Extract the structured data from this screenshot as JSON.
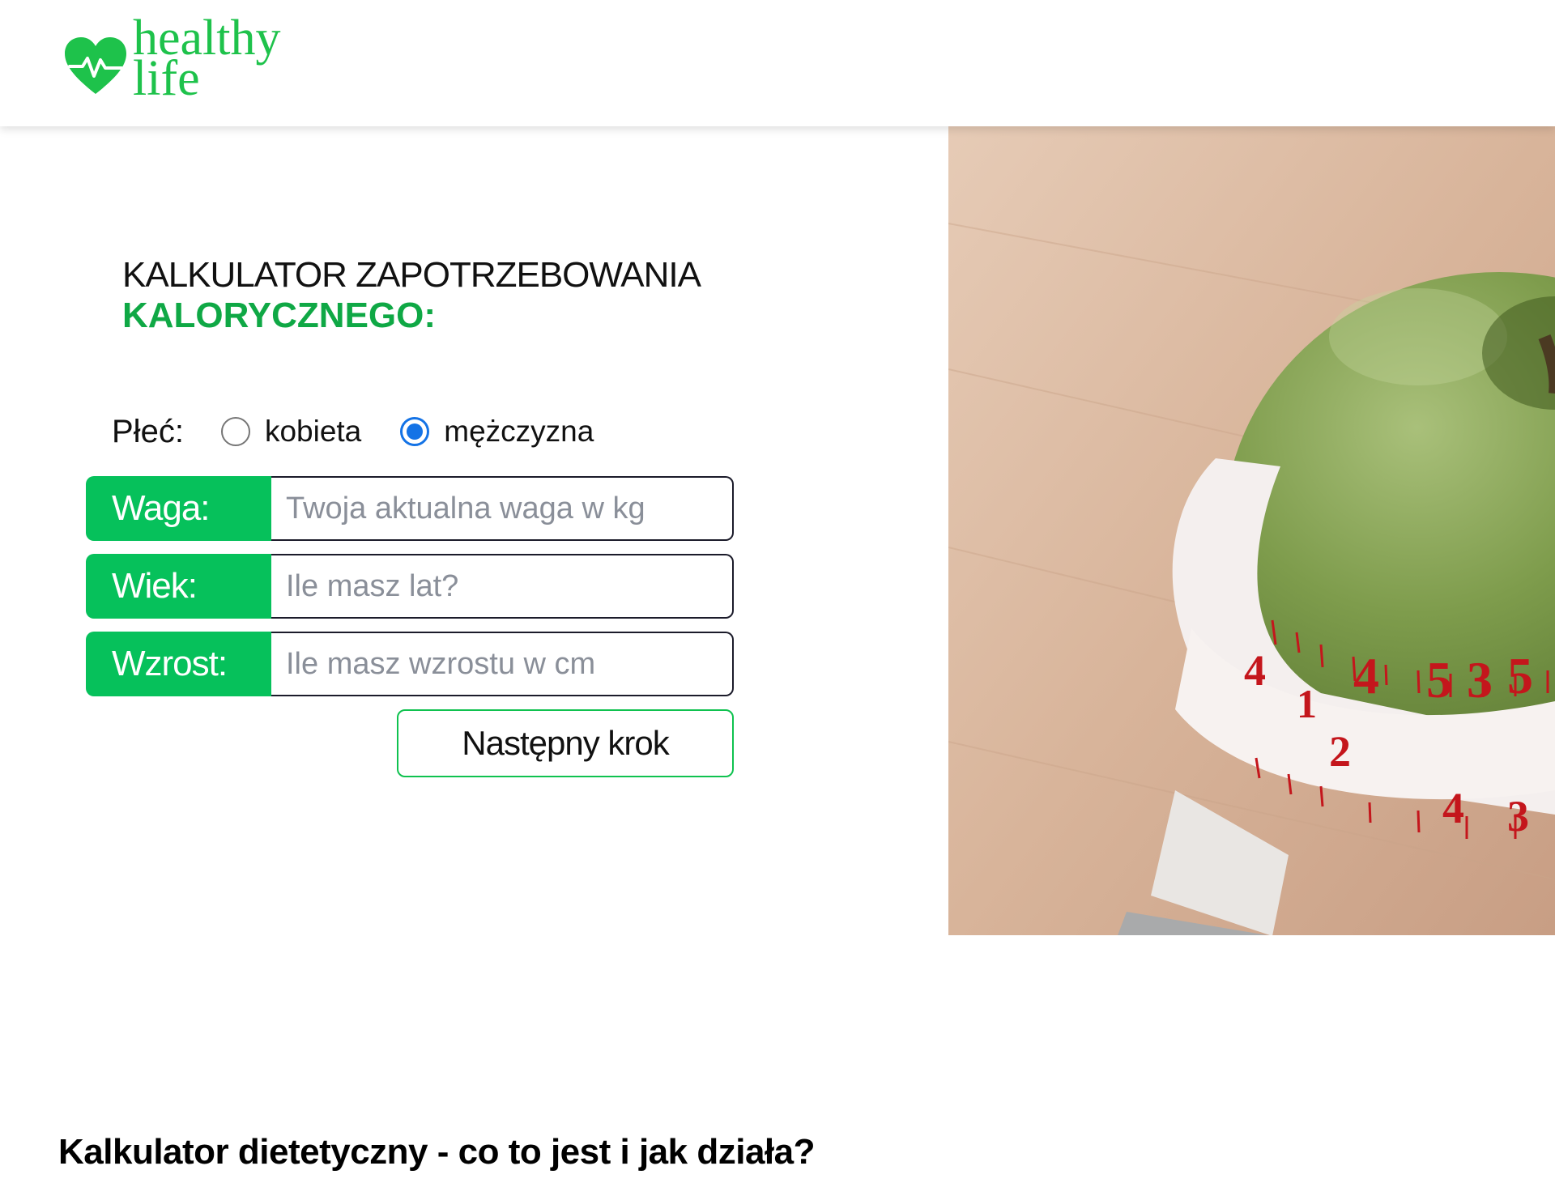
{
  "brand": {
    "name_line1": "healthy",
    "name_line2": "life",
    "color": "#1ec24b"
  },
  "calculator": {
    "title_line1": "KALKULATOR ZAPOTRZEBOWANIA",
    "title_line2": "KALORYCZNEGO:",
    "accent_color": "#06c15b",
    "gender": {
      "label": "Płeć:",
      "options": [
        {
          "label": "kobieta",
          "checked": false
        },
        {
          "label": "mężczyzna",
          "checked": true
        }
      ]
    },
    "fields": {
      "weight": {
        "label": "Waga:",
        "value": "",
        "placeholder": "Twoja aktualna waga w kg"
      },
      "age": {
        "label": "Wiek:",
        "value": "",
        "placeholder": "Ile masz lat?"
      },
      "height": {
        "label": "Wzrost:",
        "value": "",
        "placeholder": "Ile masz wzrostu w cm"
      }
    },
    "next_button_label": "Następny krok"
  },
  "hero_image": {
    "icon": "green-apple-with-measuring-tape-photo",
    "tape_numbers": [
      "4",
      "5",
      "3",
      "5",
      "4",
      "2",
      "1",
      "4",
      "3"
    ]
  },
  "article": {
    "heading": "Kalkulator dietetyczny - co to jest i jak działa?"
  }
}
